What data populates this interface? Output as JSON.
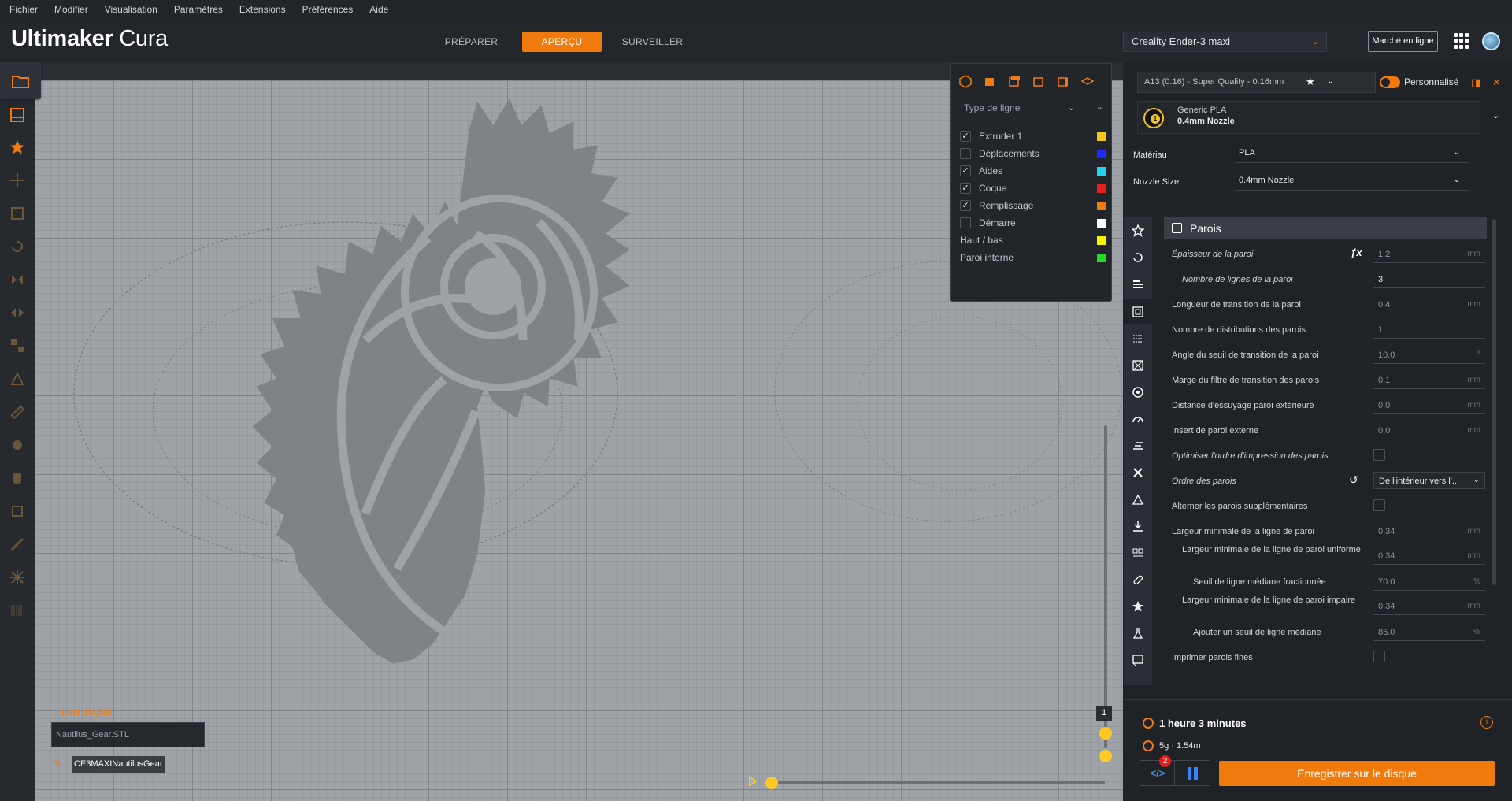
{
  "menu": [
    "Fichier",
    "Modifier",
    "Visualisation",
    "Paramètres",
    "Extensions",
    "Préférences",
    "Aide"
  ],
  "header": {
    "logo_brand": "Ultimaker",
    "logo_product": "Cura",
    "stages": [
      {
        "label": "PRÉPARER",
        "active": false
      },
      {
        "label": "APERÇU",
        "active": true
      },
      {
        "label": "SURVEILLER",
        "active": false
      }
    ],
    "printer": "Creality Ender-3 maxi",
    "marketplace": "Marché en ligne"
  },
  "legend": {
    "line_type": "Type de ligne",
    "items": [
      {
        "label": "Extruder 1",
        "checked": true,
        "color": "#f5c518"
      },
      {
        "label": "Déplacements",
        "checked": false,
        "color": "#1f2bff"
      },
      {
        "label": "Aides",
        "checked": true,
        "color": "#22d3f0"
      },
      {
        "label": "Coque",
        "checked": true,
        "color": "#e81c1c"
      },
      {
        "label": "Remplissage",
        "checked": true,
        "color": "#f07b0c"
      },
      {
        "label": "Démarre",
        "checked": false,
        "color": "#ffffff"
      },
      {
        "label": "Haut / bas",
        "checked": null,
        "color": "#f5f500"
      },
      {
        "label": "Paroi interne",
        "checked": null,
        "color": "#22dd22"
      }
    ]
  },
  "objects": {
    "list_label": "Liste d'objets",
    "file": "Nautilus_Gear.STL",
    "job_name": "CE3MAXINautilusGear"
  },
  "layer": {
    "current": "1"
  },
  "print_settings": {
    "profile": "A13 (0.16) - Super Quality - 0.16mm",
    "custom_label": "Personnalisé",
    "material_name": "Generic PLA",
    "nozzle_name": "0.4mm Nozzle",
    "extruder_number": "1",
    "material_label": "Matériau",
    "material_value": "PLA",
    "nozzle_label": "Nozzle Size",
    "nozzle_value": "0.4mm Nozzle",
    "section_title": "Parois",
    "rows": [
      {
        "label": "Épaisseur de la paroi",
        "value": "1.2",
        "unit": "mm",
        "italic": true,
        "indent": 0
      },
      {
        "label": "Nombre de lignes de la paroi",
        "value": "3",
        "unit": "",
        "italic": true,
        "indent": 1
      },
      {
        "label": "Longueur de transition de la paroi",
        "value": "0.4",
        "unit": "mm",
        "italic": false,
        "indent": 0
      },
      {
        "label": "Nombre de distributions des parois",
        "value": "1",
        "unit": "",
        "italic": false,
        "indent": 0
      },
      {
        "label": "Angle du seuil de transition de la paroi",
        "value": "10.0",
        "unit": "°",
        "italic": false,
        "indent": 0
      },
      {
        "label": "Marge du filtre de transition des parois",
        "value": "0.1",
        "unit": "mm",
        "italic": false,
        "indent": 0
      },
      {
        "label": "Distance d'essuyage paroi extérieure",
        "value": "0.0",
        "unit": "mm",
        "italic": false,
        "indent": 0
      },
      {
        "label": "Insert de paroi externe",
        "value": "0.0",
        "unit": "mm",
        "italic": false,
        "indent": 0
      },
      {
        "label": "Optimiser l'ordre d'impression des parois",
        "checkbox": true,
        "italic": true,
        "indent": 0
      },
      {
        "label": "Ordre des parois",
        "dropdown": "De l'intérieur vers l'...",
        "italic": true,
        "indent": 0
      },
      {
        "label": "Alterner les parois supplémentaires",
        "checkbox": true,
        "italic": false,
        "indent": 0
      },
      {
        "label": "Largeur minimale de la ligne de paroi",
        "value": "0.34",
        "unit": "mm",
        "italic": false,
        "indent": 0
      },
      {
        "label": "Largeur minimale de la ligne de paroi uniforme",
        "value": "0.34",
        "unit": "mm",
        "italic": false,
        "indent": 1
      },
      {
        "label": "Seuil de ligne médiane fractionnée",
        "value": "70.0",
        "unit": "%",
        "italic": false,
        "indent": 2
      },
      {
        "label": "Largeur minimale de la ligne de paroi impaire",
        "value": "0.34",
        "unit": "mm",
        "italic": false,
        "indent": 1
      },
      {
        "label": "Ajouter un seuil de ligne médiane",
        "value": "85.0",
        "unit": "%",
        "italic": false,
        "indent": 2
      },
      {
        "label": "Imprimer parois fines",
        "checkbox": true,
        "italic": false,
        "indent": 0
      }
    ]
  },
  "estimate": {
    "time": "1 heure 3 minutes",
    "material": "5g · 1.54m",
    "badge": "2",
    "save_label": "Enregistrer sur le disque"
  },
  "colors": {
    "accent": "#f07b0c",
    "slider": "#ffc924"
  }
}
